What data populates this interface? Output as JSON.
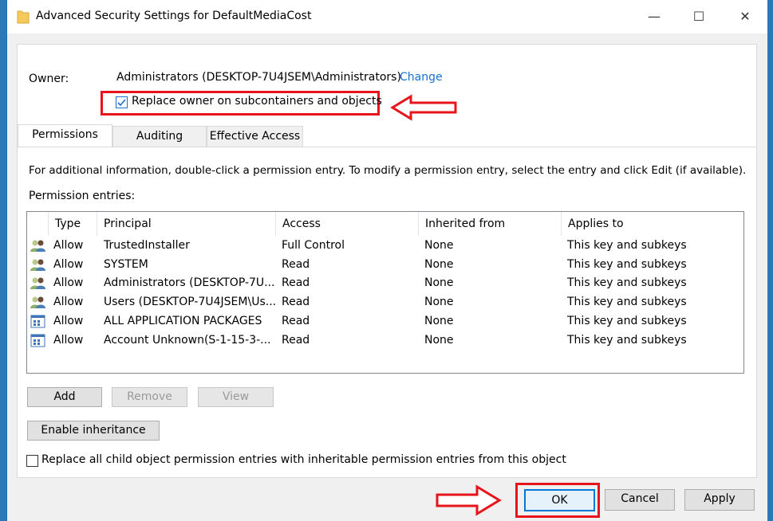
{
  "window": {
    "title": "Advanced Security Settings for DefaultMediaCost",
    "minimize": "—",
    "maximize": "☐",
    "close": "✕"
  },
  "owner": {
    "label": "Owner:",
    "value": "Administrators (DESKTOP-7U4JSEM\\Administrators)",
    "change_link": "Change",
    "replace_checkbox_label": "Replace owner on subcontainers and objects",
    "replace_checked": true
  },
  "tabs": [
    {
      "label": "Permissions",
      "active": true
    },
    {
      "label": "Auditing"
    },
    {
      "label": "Effective Access"
    }
  ],
  "info_text": "For additional information, double-click a permission entry. To modify a permission entry, select the entry and click Edit (if available).",
  "entries_label": "Permission entries:",
  "columns": [
    "Type",
    "Principal",
    "Access",
    "Inherited from",
    "Applies to"
  ],
  "rows": [
    {
      "icon": "users-icon",
      "type": "Allow",
      "principal": "TrustedInstaller",
      "access": "Full Control",
      "inherited": "None",
      "applies": "This key and subkeys"
    },
    {
      "icon": "users-icon",
      "type": "Allow",
      "principal": "SYSTEM",
      "access": "Read",
      "inherited": "None",
      "applies": "This key and subkeys"
    },
    {
      "icon": "users-icon",
      "type": "Allow",
      "principal": "Administrators (DESKTOP-7U...",
      "access": "Read",
      "inherited": "None",
      "applies": "This key and subkeys"
    },
    {
      "icon": "users-icon",
      "type": "Allow",
      "principal": "Users (DESKTOP-7U4JSEM\\Us...",
      "access": "Read",
      "inherited": "None",
      "applies": "This key and subkeys"
    },
    {
      "icon": "app-packages-icon",
      "type": "Allow",
      "principal": "ALL APPLICATION PACKAGES",
      "access": "Read",
      "inherited": "None",
      "applies": "This key and subkeys"
    },
    {
      "icon": "app-package-icon",
      "type": "Allow",
      "principal": "Account Unknown(S-1-15-3-...",
      "access": "Read",
      "inherited": "None",
      "applies": "This key and subkeys"
    }
  ],
  "buttons": {
    "add": "Add",
    "remove": "Remove",
    "view": "View",
    "enable_inheritance": "Enable inheritance",
    "ok": "OK",
    "cancel": "Cancel",
    "apply": "Apply"
  },
  "replace_child_label": "Replace all child object permission entries with inheritable permission entries from this object",
  "replace_child_checked": false,
  "annotation_color": "#e8141c"
}
